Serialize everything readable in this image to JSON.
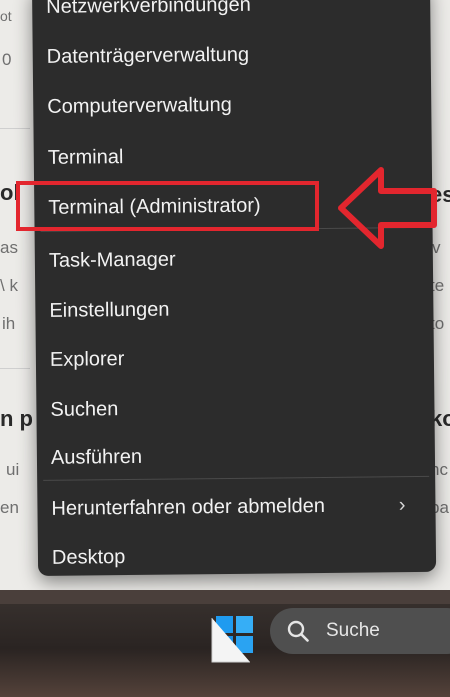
{
  "background_page": {
    "fragments": [
      {
        "id": "frag-1",
        "text": "ot"
      },
      {
        "id": "frag-2",
        "text": "0"
      },
      {
        "id": "frag-3",
        "text": "ol"
      },
      {
        "id": "frag-4",
        "text": "as"
      },
      {
        "id": "frag-5",
        "text": "\\ k"
      },
      {
        "id": "frag-6",
        "text": "ih"
      },
      {
        "id": "frag-7",
        "text": "n p"
      },
      {
        "id": "frag-8",
        "text": "ui"
      },
      {
        "id": "frag-9",
        "text": "en"
      },
      {
        "id": "frag-10",
        "text": "es"
      },
      {
        "id": "frag-11",
        "text": "v"
      },
      {
        "id": "frag-12",
        "text": "te"
      },
      {
        "id": "frag-13",
        "text": "to"
      },
      {
        "id": "frag-14",
        "text": "ko"
      },
      {
        "id": "frag-15",
        "text": "nc"
      },
      {
        "id": "frag-16",
        "text": "ba"
      }
    ]
  },
  "context_menu": {
    "items": [
      {
        "label": "Netzwerkverbindungen"
      },
      {
        "label": "Datenträgerverwaltung"
      },
      {
        "label": "Computerverwaltung"
      },
      {
        "label": "Terminal"
      },
      {
        "label": "Terminal (Administrator)"
      },
      {
        "label": "Task-Manager"
      },
      {
        "label": "Einstellungen"
      },
      {
        "label": "Explorer"
      },
      {
        "label": "Suchen"
      },
      {
        "label": "Ausführen"
      },
      {
        "label": "Herunterfahren oder abmelden",
        "submenu_icon": "chevron-right-icon",
        "submenu_glyph": "›"
      },
      {
        "label": "Desktop"
      }
    ],
    "highlighted_item": "Terminal (Administrator)"
  },
  "annotation": {
    "color": "#e3262e",
    "arrow_icon": "left-arrow-outline-icon"
  },
  "taskbar": {
    "start_icon": "windows-start-icon",
    "search": {
      "icon": "search-icon",
      "label": "Suche"
    }
  },
  "colors": {
    "menu_background": "#2c2c2c",
    "menu_text": "#f2f2f2",
    "highlight": "#e3262e",
    "windows_blue": "#1f9bf0"
  }
}
